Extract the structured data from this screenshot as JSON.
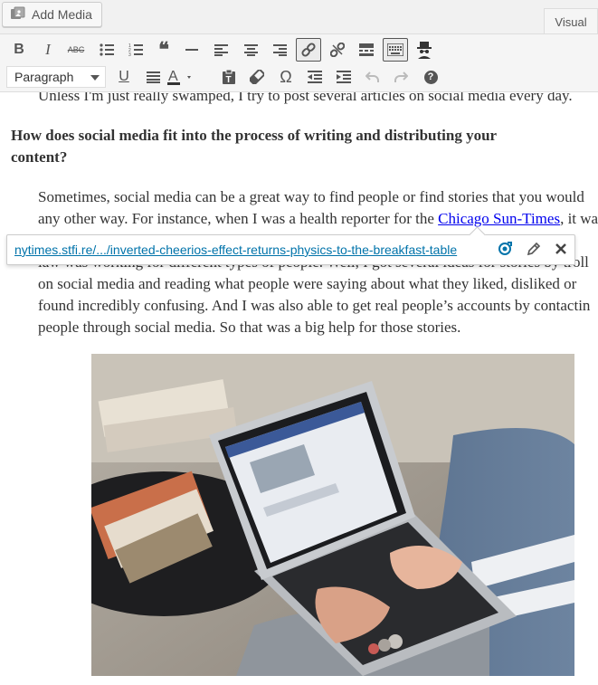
{
  "top": {
    "add_media_label": "Add Media",
    "tab_visual": "Visual"
  },
  "toolbar": {
    "format_select": "Paragraph",
    "row1": [
      "bold-icon",
      "italic-icon",
      "strikethrough-icon",
      "bullet-list-icon",
      "numbered-list-icon",
      "blockquote-icon",
      "horizontal-rule-icon",
      "align-left-icon",
      "align-center-icon",
      "align-right-icon",
      "link-icon",
      "unlink-icon",
      "read-more-icon",
      "toolbar-toggle-icon",
      "spy-icon"
    ],
    "row2": [
      "underline-icon",
      "justify-icon",
      "text-color-icon",
      "paste-text-icon",
      "clear-formatting-icon",
      "special-character-icon",
      "outdent-icon",
      "indent-icon",
      "undo-icon",
      "redo-icon",
      "help-icon"
    ],
    "bold": "B",
    "italic": "I",
    "strike": "ABC",
    "blockquote": "❝",
    "underline": "U",
    "omega": "Ω",
    "help": "?"
  },
  "content": {
    "line0": "Unless I'm just really swamped, I try to post several articles on social media every day.",
    "heading_line1": "How does social media fit into the process of writing and distributing your",
    "heading_line2": "content?",
    "para_line1": "Sometimes, social media can be a great way to find people or find stories that you would",
    "para_line2_before": "any other way. For instance, when I was a health reporter for the ",
    "para_line2_link": "Chicago Sun-Times",
    "para_line2_after": ", it was",
    "para_line3": "law was working for different types of people. Well, I got several ideas for stories by troll",
    "para_line4": "on social media and reading what people were saying about what they liked, disliked or",
    "para_line5": "found incredibly confusing. And I was also able to get real people’s accounts by contactin",
    "para_line6": "people through social media. So that was a big help for those stories."
  },
  "link_popup": {
    "url": "nytimes.stfi.re/.../inverted-cheerios-effect-returns-physics-to-the-breakfast-table"
  },
  "colors": {
    "link": "#0000ee",
    "popup_link": "#0073aa",
    "toolbar_bg": "#f5f5f5"
  }
}
